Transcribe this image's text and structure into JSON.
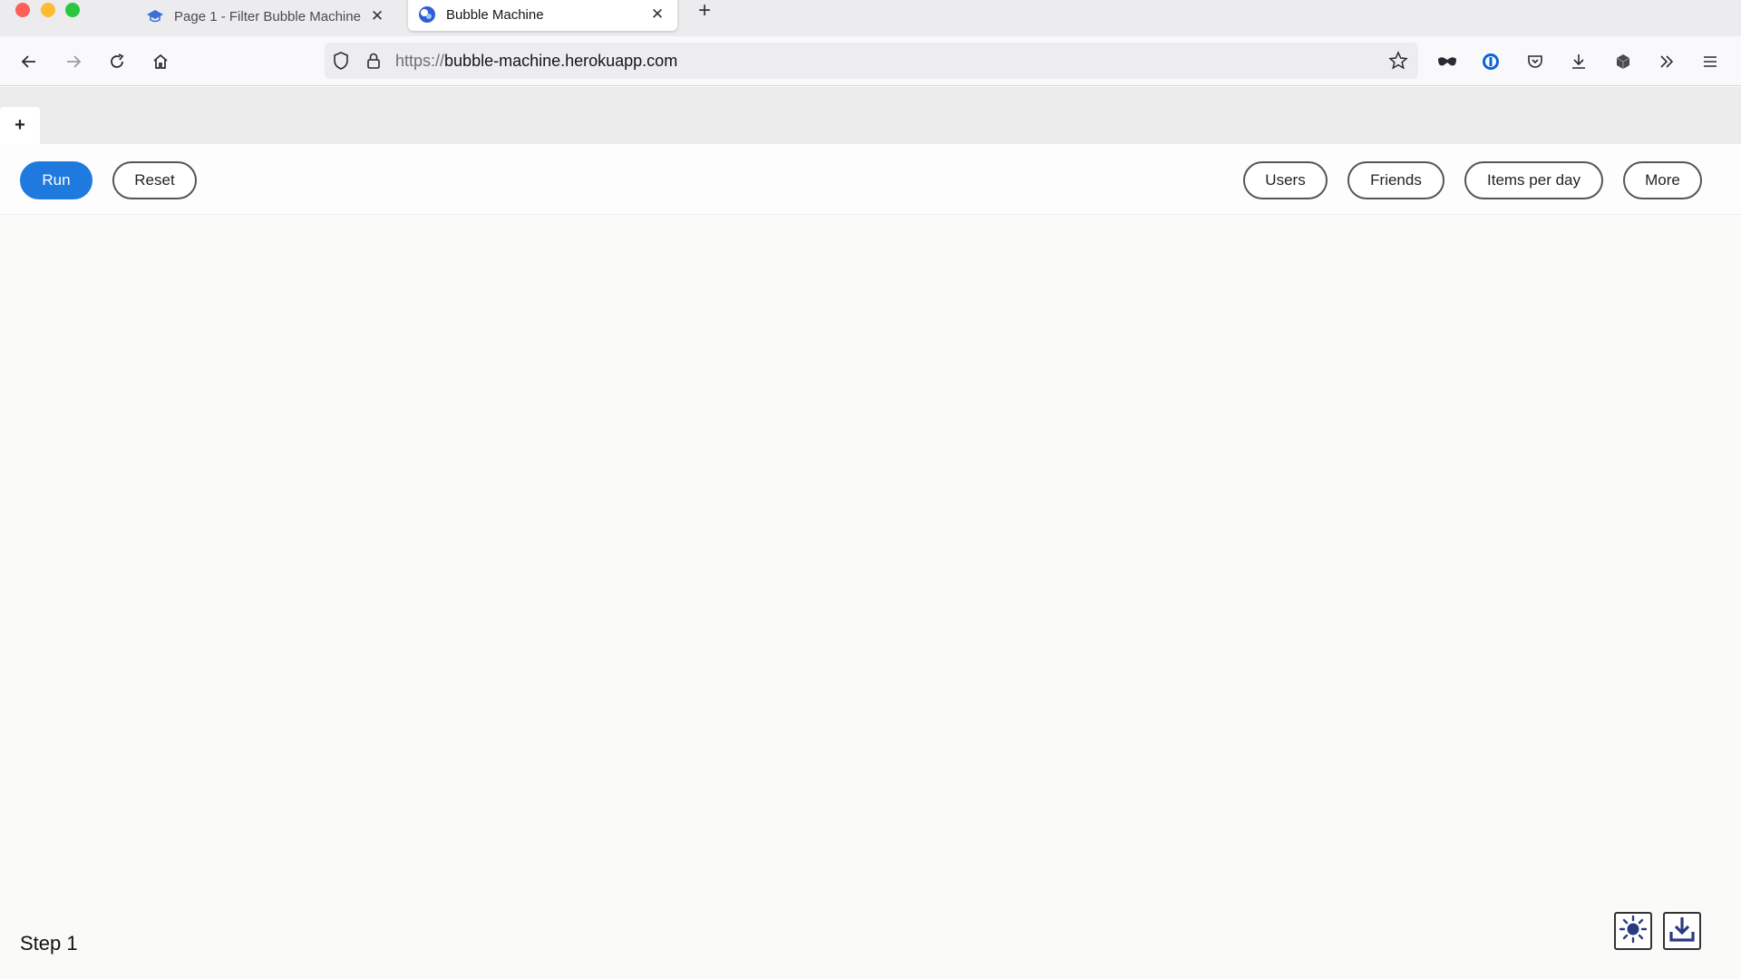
{
  "browser": {
    "tabs": [
      {
        "title": "Page 1 - Filter Bubble Machine",
        "active": false,
        "close": "✕"
      },
      {
        "title": "Bubble Machine",
        "active": true,
        "close": "✕"
      }
    ],
    "new_tab": "+",
    "url_scheme": "https://",
    "url_host": "bubble-machine.herokuapp.com"
  },
  "page": {
    "add_tab_label": "+",
    "buttons": {
      "run": "Run",
      "reset": "Reset",
      "users": "Users",
      "friends": "Friends",
      "items_per_day": "Items per day",
      "more": "More"
    },
    "step_label": "Step 1"
  },
  "colors": {
    "primary": "#1f7ae0"
  }
}
